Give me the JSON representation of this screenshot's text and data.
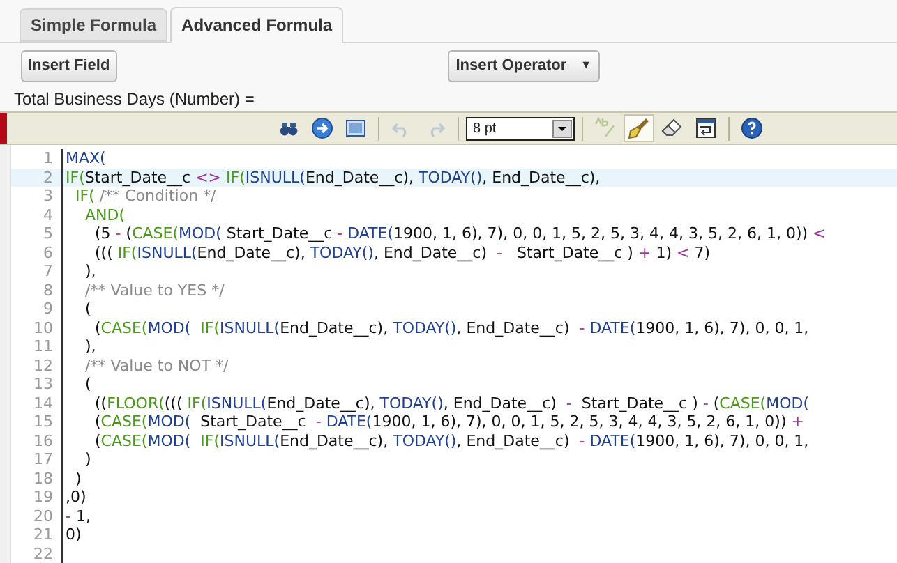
{
  "tabs": [
    {
      "label": "Simple Formula",
      "selected": false
    },
    {
      "label": "Advanced Formula",
      "selected": true
    }
  ],
  "buttons": [
    {
      "label": "Insert Field",
      "kind": "button"
    },
    {
      "label": "Insert Operator",
      "kind": "dropdown",
      "caret": "▼"
    }
  ],
  "formula_label": "Total Business Days (Number) =",
  "toolbar": [
    {
      "kind": "find",
      "disabled": false
    },
    {
      "kind": "goto",
      "disabled": false
    },
    {
      "kind": "fullscreen",
      "disabled": false
    },
    {
      "kind": "separator"
    },
    {
      "kind": "undo",
      "disabled": true
    },
    {
      "kind": "redo",
      "disabled": true
    },
    {
      "kind": "separator"
    },
    {
      "kind": "font_size",
      "value": "8 pt"
    },
    {
      "kind": "separator"
    },
    {
      "kind": "spellcheck",
      "disabled": true
    },
    {
      "kind": "highlight",
      "disabled": false,
      "pressed": true
    },
    {
      "kind": "clear",
      "disabled": false
    },
    {
      "kind": "wrap",
      "disabled": false
    },
    {
      "kind": "separator"
    },
    {
      "kind": "help",
      "disabled": false
    }
  ],
  "code_lines": [
    {
      "number": "1",
      "selected": false,
      "tokens": [
        {
          "text": "MAX(",
          "kind": "function"
        }
      ]
    },
    {
      "number": "2",
      "selected": true,
      "tokens": [
        {
          "text": "IF(",
          "kind": "keyword"
        },
        {
          "text": "Start_Date__c ",
          "kind": "plain"
        },
        {
          "text": "<> ",
          "kind": "operator"
        },
        {
          "text": "IF(",
          "kind": "keyword"
        },
        {
          "text": "ISNULL(",
          "kind": "function"
        },
        {
          "text": "End_Date__c), ",
          "kind": "plain"
        },
        {
          "text": "TODAY()",
          "kind": "function"
        },
        {
          "text": ", End_Date__c),",
          "kind": "plain"
        }
      ]
    },
    {
      "number": "3",
      "selected": false,
      "tokens": [
        {
          "text": "  IF(",
          "kind": "keyword"
        },
        {
          "text": " /** Condition */",
          "kind": "comment"
        }
      ]
    },
    {
      "number": "4",
      "selected": false,
      "tokens": [
        {
          "text": "    AND(",
          "kind": "keyword"
        }
      ]
    },
    {
      "number": "5",
      "selected": false,
      "tokens": [
        {
          "text": "      (5 ",
          "kind": "plain"
        },
        {
          "text": "-",
          "kind": "operator"
        },
        {
          "text": " (",
          "kind": "plain"
        },
        {
          "text": "CASE(",
          "kind": "keyword"
        },
        {
          "text": "MOD(",
          "kind": "function"
        },
        {
          "text": " Start_Date__c ",
          "kind": "plain"
        },
        {
          "text": "- ",
          "kind": "operator"
        },
        {
          "text": "DATE(",
          "kind": "function"
        },
        {
          "text": "1900, 1, 6), 7), 0, 0, 1, 5, 2, 5, 3, 4, 4, 3, 5, 2, 6, 1, 0)) ",
          "kind": "plain"
        },
        {
          "text": "<",
          "kind": "operator"
        }
      ]
    },
    {
      "number": "6",
      "selected": false,
      "tokens": [
        {
          "text": "      ((( ",
          "kind": "plain"
        },
        {
          "text": "IF(",
          "kind": "keyword"
        },
        {
          "text": "ISNULL(",
          "kind": "function"
        },
        {
          "text": "End_Date__c), ",
          "kind": "plain"
        },
        {
          "text": "TODAY()",
          "kind": "function"
        },
        {
          "text": ", End_Date__c)  ",
          "kind": "plain"
        },
        {
          "text": "-",
          "kind": "operator"
        },
        {
          "text": "   Start_Date__c ) ",
          "kind": "plain"
        },
        {
          "text": "+",
          "kind": "operator"
        },
        {
          "text": " 1) ",
          "kind": "plain"
        },
        {
          "text": "<",
          "kind": "operator"
        },
        {
          "text": " 7)",
          "kind": "plain"
        }
      ]
    },
    {
      "number": "7",
      "selected": false,
      "tokens": [
        {
          "text": "    ),",
          "kind": "plain"
        }
      ]
    },
    {
      "number": "8",
      "selected": false,
      "tokens": [
        {
          "text": "    /** Value to YES */",
          "kind": "comment"
        }
      ]
    },
    {
      "number": "9",
      "selected": false,
      "tokens": [
        {
          "text": "    (",
          "kind": "plain"
        }
      ]
    },
    {
      "number": "10",
      "selected": false,
      "tokens": [
        {
          "text": "      (",
          "kind": "plain"
        },
        {
          "text": "CASE(",
          "kind": "keyword"
        },
        {
          "text": "MOD(  ",
          "kind": "function"
        },
        {
          "text": "IF(",
          "kind": "keyword"
        },
        {
          "text": "ISNULL(",
          "kind": "function"
        },
        {
          "text": "End_Date__c), ",
          "kind": "plain"
        },
        {
          "text": "TODAY()",
          "kind": "function"
        },
        {
          "text": ", End_Date__c)  ",
          "kind": "plain"
        },
        {
          "text": "- ",
          "kind": "operator"
        },
        {
          "text": "DATE(",
          "kind": "function"
        },
        {
          "text": "1900, 1, 6), 7), 0, 0, 1,",
          "kind": "plain"
        }
      ]
    },
    {
      "number": "11",
      "selected": false,
      "tokens": [
        {
          "text": "    ),",
          "kind": "plain"
        }
      ]
    },
    {
      "number": "12",
      "selected": false,
      "tokens": [
        {
          "text": "    /** Value to NOT */",
          "kind": "comment"
        }
      ]
    },
    {
      "number": "13",
      "selected": false,
      "tokens": [
        {
          "text": "    (",
          "kind": "plain"
        }
      ]
    },
    {
      "number": "14",
      "selected": false,
      "tokens": [
        {
          "text": "      ((",
          "kind": "plain"
        },
        {
          "text": "FLOOR(",
          "kind": "keyword"
        },
        {
          "text": "((( ",
          "kind": "plain"
        },
        {
          "text": "IF(",
          "kind": "keyword"
        },
        {
          "text": "ISNULL(",
          "kind": "function"
        },
        {
          "text": "End_Date__c), ",
          "kind": "plain"
        },
        {
          "text": "TODAY()",
          "kind": "function"
        },
        {
          "text": ", End_Date__c)  ",
          "kind": "plain"
        },
        {
          "text": "-",
          "kind": "operator"
        },
        {
          "text": "  Start_Date__c ) ",
          "kind": "plain"
        },
        {
          "text": "-",
          "kind": "operator"
        },
        {
          "text": " (",
          "kind": "plain"
        },
        {
          "text": "CASE(",
          "kind": "keyword"
        },
        {
          "text": "MOD(",
          "kind": "function"
        }
      ]
    },
    {
      "number": "15",
      "selected": false,
      "tokens": [
        {
          "text": "      (",
          "kind": "plain"
        },
        {
          "text": "CASE(",
          "kind": "keyword"
        },
        {
          "text": "MOD(",
          "kind": "function"
        },
        {
          "text": "  Start_Date__c  ",
          "kind": "plain"
        },
        {
          "text": "- ",
          "kind": "operator"
        },
        {
          "text": "DATE(",
          "kind": "function"
        },
        {
          "text": "1900, 1, 6), 7), 0, 0, 1, 5, 2, 5, 3, 4, 4, 3, 5, 2, 6, 1, 0)) ",
          "kind": "plain"
        },
        {
          "text": "+",
          "kind": "operator"
        }
      ]
    },
    {
      "number": "16",
      "selected": false,
      "tokens": [
        {
          "text": "      (",
          "kind": "plain"
        },
        {
          "text": "CASE(",
          "kind": "keyword"
        },
        {
          "text": "MOD(  ",
          "kind": "function"
        },
        {
          "text": "IF(",
          "kind": "keyword"
        },
        {
          "text": "ISNULL(",
          "kind": "function"
        },
        {
          "text": "End_Date__c), ",
          "kind": "plain"
        },
        {
          "text": "TODAY()",
          "kind": "function"
        },
        {
          "text": ", End_Date__c)  ",
          "kind": "plain"
        },
        {
          "text": "- ",
          "kind": "operator"
        },
        {
          "text": "DATE(",
          "kind": "function"
        },
        {
          "text": "1900, 1, 6), 7), 0, 0, 1,",
          "kind": "plain"
        }
      ]
    },
    {
      "number": "17",
      "selected": false,
      "tokens": [
        {
          "text": "    )",
          "kind": "plain"
        }
      ]
    },
    {
      "number": "18",
      "selected": false,
      "tokens": [
        {
          "text": "  )",
          "kind": "plain"
        }
      ]
    },
    {
      "number": "19",
      "selected": false,
      "tokens": [
        {
          "text": ",0)",
          "kind": "plain"
        }
      ]
    },
    {
      "number": "20",
      "selected": false,
      "tokens": [
        {
          "text": "-",
          "kind": "operator"
        },
        {
          "text": " 1,",
          "kind": "plain"
        }
      ]
    },
    {
      "number": "21",
      "selected": false,
      "tokens": [
        {
          "text": "0)",
          "kind": "plain"
        }
      ]
    },
    {
      "number": "22",
      "selected": false
    }
  ]
}
